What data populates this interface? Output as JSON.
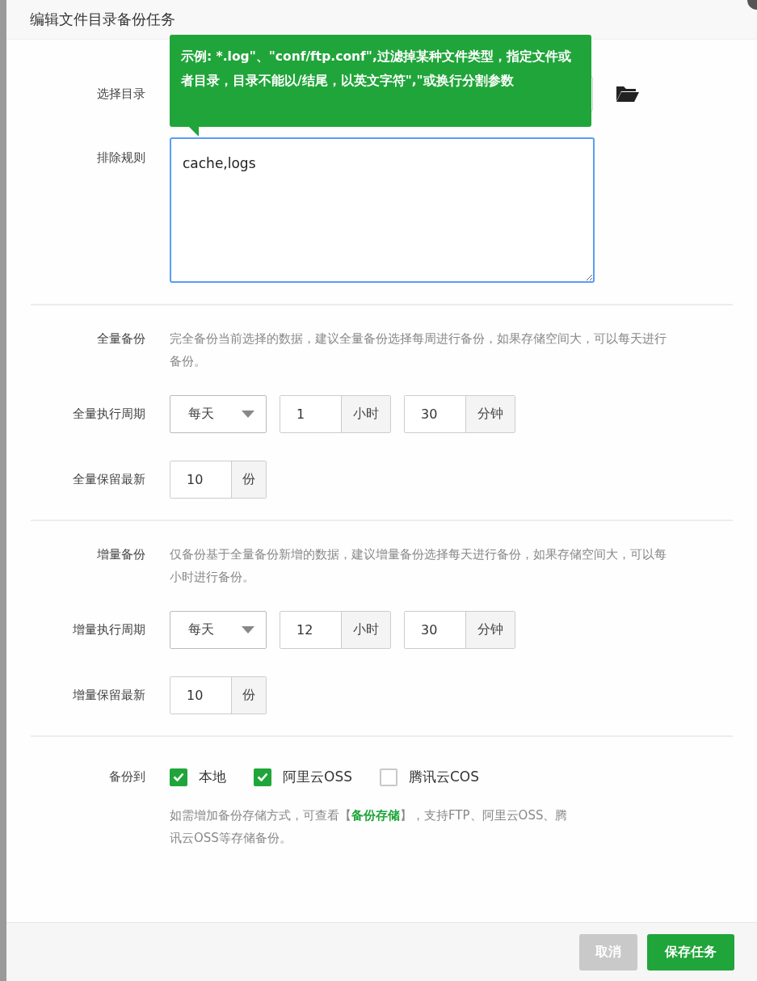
{
  "dialog": {
    "title": "编辑文件目录备份任务"
  },
  "tooltip": {
    "text": "示例: *.log\"、\"conf/ftp.conf\",过滤掉某种文件类型，指定文件或者目录，目录不能以/结尾，以英文字符\",\"或换行分割参数"
  },
  "directory": {
    "label": "选择目录"
  },
  "exclude": {
    "label": "排除规则",
    "value": "cache,logs"
  },
  "sections": [
    {
      "title": "全量备份",
      "description": "完全备份当前选择的数据，建议全量备份选择每周进行备份，如果存储空间大，可以每天进行备份。",
      "period_label": "全量执行周期",
      "period": "每天",
      "hour": "1",
      "hour_unit": "小时",
      "minute": "30",
      "minute_unit": "分钟",
      "keep_label": "全量保留最新",
      "keep": "10",
      "keep_unit": "份"
    },
    {
      "title": "增量备份",
      "description": "仅备份基于全量备份新增的数据，建议增量备份选择每天进行备份，如果存储空间大，可以每小时进行备份。",
      "period_label": "增量执行周期",
      "period": "每天",
      "hour": "12",
      "hour_unit": "小时",
      "minute": "30",
      "minute_unit": "分钟",
      "keep_label": "增量保留最新",
      "keep": "10",
      "keep_unit": "份"
    }
  ],
  "destinations": {
    "label": "备份到",
    "options": [
      {
        "label": "本地",
        "checked": true
      },
      {
        "label": "阿里云OSS",
        "checked": true
      },
      {
        "label": "腾讯云COS",
        "checked": false
      }
    ]
  },
  "note": {
    "before": "如需增加备份存储方式，可查看【",
    "link": "备份存储",
    "after": "】，支持FTP、阿里云OSS、腾讯云OSS等存储备份。"
  },
  "buttons": [
    {
      "label": "取消",
      "kind": "cancel"
    },
    {
      "label": "保存任务",
      "kind": "primary"
    }
  ]
}
